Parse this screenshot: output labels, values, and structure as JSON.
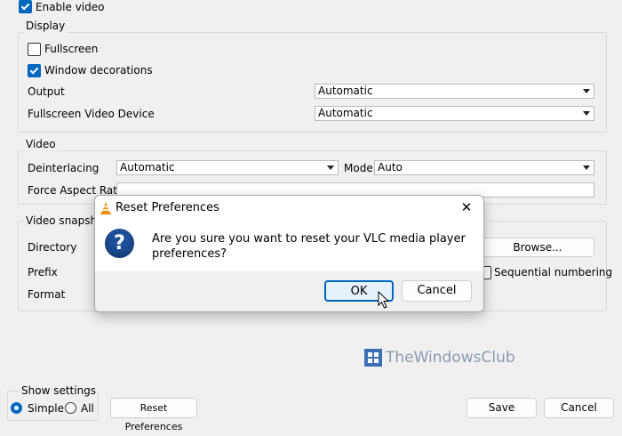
{
  "enable_video": {
    "label": "Enable video",
    "checked": true
  },
  "display": {
    "title": "Display",
    "fullscreen": {
      "label": "Fullscreen",
      "checked": false
    },
    "window_decorations": {
      "label": "Window decorations",
      "checked": true
    },
    "output_label": "Output",
    "output_value": "Automatic",
    "fullscreen_device_label": "Fullscreen Video Device",
    "fullscreen_device_value": "Automatic"
  },
  "video": {
    "title": "Video",
    "deinterlacing_label": "Deinterlacing",
    "deinterlacing_value": "Automatic",
    "mode_label": "Mode",
    "mode_value": "Auto",
    "aspect_label": "Force Aspect Ratio",
    "aspect_value": ""
  },
  "snapshots": {
    "title": "Video snapshots",
    "directory_label": "Directory",
    "browse_label": "Browse...",
    "prefix_label": "Prefix",
    "sequential_label": "Sequential numbering",
    "sequential_checked": false,
    "format_label": "Format"
  },
  "dialog": {
    "title": "Reset Preferences",
    "message_line1": "Are you sure you want to reset your VLC media player",
    "message_line2": "preferences?",
    "ok_label": "OK",
    "cancel_label": "Cancel",
    "close_glyph": "✕",
    "question_glyph": "?"
  },
  "watermark": {
    "text": "TheWindowsClub"
  },
  "footer": {
    "show_settings_label": "Show settings",
    "simple_label": "Simple",
    "all_label": "All",
    "selected": "Simple",
    "reset_label": "Reset Preferences",
    "save_label": "Save",
    "cancel_label": "Cancel"
  },
  "colors": {
    "accent": "#0067c0",
    "vlc_orange": "#f08c00",
    "question_blue": "#1e4f9a"
  }
}
